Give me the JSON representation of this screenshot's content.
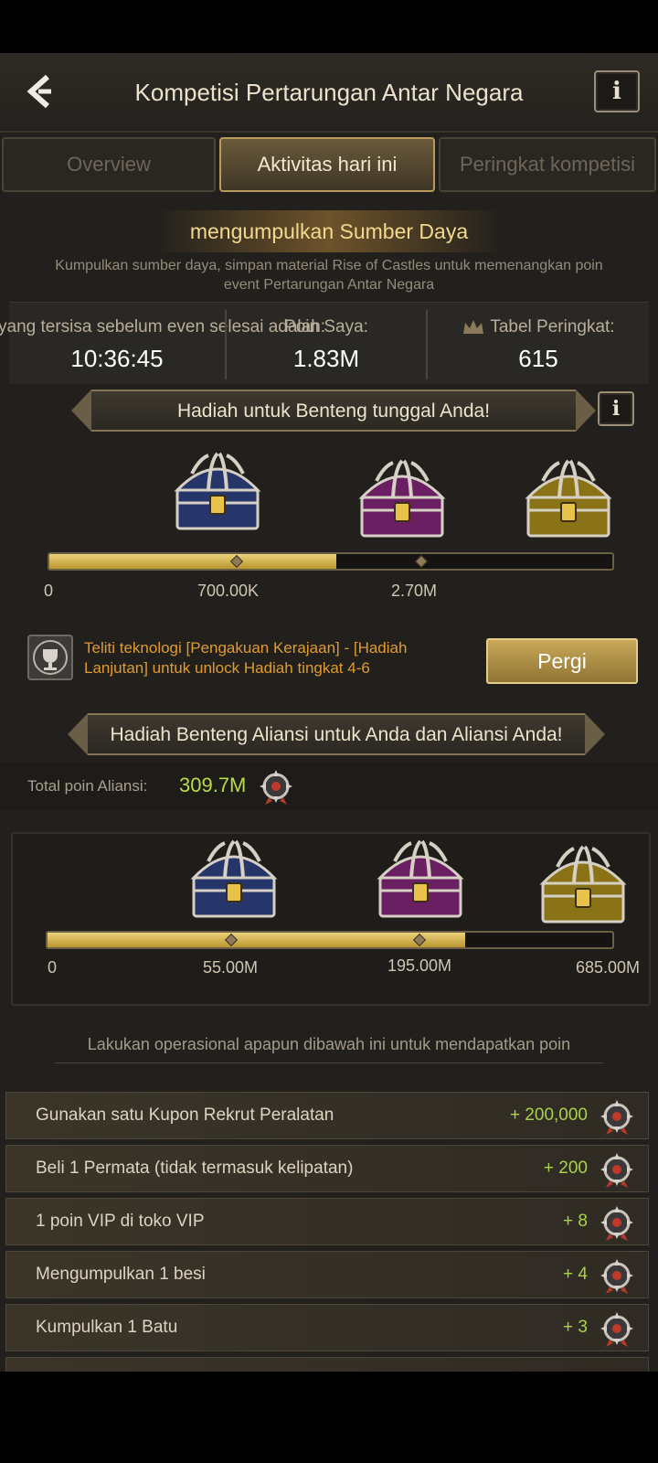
{
  "header": {
    "title": "Kompetisi Pertarungan Antar Negara",
    "info_label": "i"
  },
  "tabs": [
    {
      "label": "Overview",
      "active": false
    },
    {
      "label": "Aktivitas hari ini",
      "active": true
    },
    {
      "label": "Peringkat kompetisi",
      "active": false
    }
  ],
  "activity": {
    "title": "mengumpulkan Sumber Daya",
    "description": "Kumpulkan sumber daya, simpan material Rise of Castles untuk memenangkan poin event Pertarungan Antar Negara"
  },
  "stats": {
    "time_label": "yang tersisa sebelum even selesai adalah:",
    "time_value": "10:36:45",
    "points_label": "Poin Saya:",
    "points_value": "1.83M",
    "rank_label": "Tabel Peringkat:",
    "rank_value": "615"
  },
  "single_reward": {
    "ribbon": "Hadiah untuk Benteng tunggal Anda!",
    "info_label": "i",
    "progress_fraction": 0.51,
    "ticks": [
      "0",
      "700.00K",
      "2.70M"
    ],
    "tech_text": "Teliti teknologi [Pengakuan Kerajaan] - [Hadiah Lanjutan] untuk unlock Hadiah tingkat 4-6",
    "go_button": "Pergi"
  },
  "alliance_reward": {
    "ribbon": "Hadiah Benteng Aliansi untuk Anda dan Aliansi Anda!",
    "total_label": "Total poin Aliansi:",
    "total_value": "309.7M",
    "progress_fraction": 0.74,
    "ticks": [
      "0",
      "55.00M",
      "195.00M",
      "685.00M"
    ]
  },
  "operations": {
    "title": "Lakukan operasional apapun dibawah ini untuk mendapatkan poin",
    "tasks": [
      {
        "label": "Gunakan satu Kupon Rekrut Peralatan",
        "points": "+ 200,000"
      },
      {
        "label": "Beli 1 Permata (tidak termasuk kelipatan)",
        "points": "+ 200"
      },
      {
        "label": "1 poin VIP di toko VIP",
        "points": "+ 8"
      },
      {
        "label": "Mengumpulkan 1 besi",
        "points": "+ 4"
      },
      {
        "label": "Kumpulkan 1 Batu",
        "points": "+ 3"
      }
    ]
  },
  "colors": {
    "accent_gold": "#f2d98e",
    "points_green": "#a9d24a",
    "warning_orange": "#e09a2e"
  }
}
